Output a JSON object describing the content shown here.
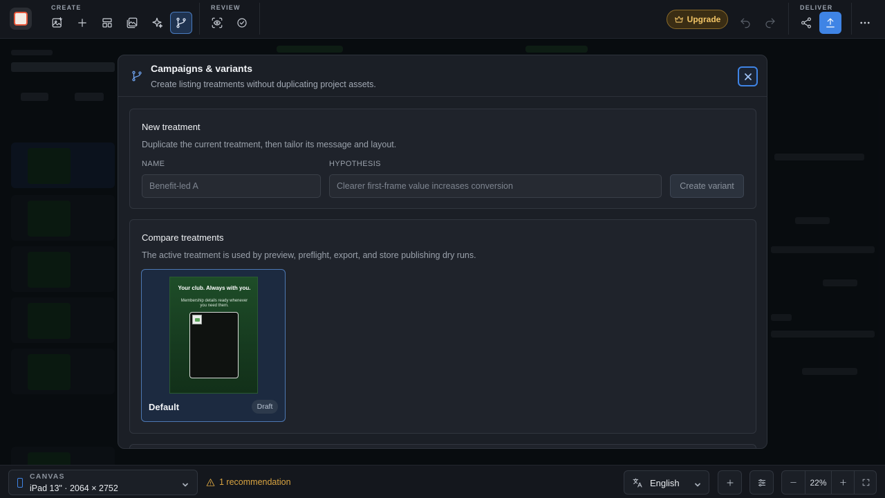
{
  "toolbar": {
    "create_label": "CREATE",
    "review_label": "REVIEW",
    "deliver_label": "DELIVER",
    "upgrade_label": "Upgrade",
    "icons": {
      "create": [
        "image-add-icon",
        "plus-icon",
        "layout-icon",
        "gallery-icon",
        "sparkles-icon",
        "branch-icon"
      ],
      "review": [
        "eye-scan-icon",
        "check-circle-icon"
      ],
      "deliver": [
        "share-icon",
        "upload-icon"
      ]
    },
    "colors": {
      "accent": "#3f84e5",
      "upgrade": "#f3c567"
    }
  },
  "modal": {
    "title": "Campaigns & variants",
    "subtitle": "Create listing treatments without duplicating project assets.",
    "new_treatment": {
      "title": "New treatment",
      "description": "Duplicate the current treatment, then tailor its message and layout.",
      "name_label": "NAME",
      "name_value": "",
      "name_placeholder": "Benefit-led A",
      "hypothesis_label": "HYPOTHESIS",
      "hypothesis_value": "",
      "hypothesis_placeholder": "Clearer first-frame value increases conversion",
      "create_button": "Create variant"
    },
    "compare": {
      "title": "Compare treatments",
      "description": "The active treatment is used by preview, preflight, export, and store publishing dry runs.",
      "variants": [
        {
          "name": "Default",
          "status": "Draft",
          "preview_headline": "Your club. Always with you.",
          "preview_subtext": "Membership details ready whenever you need them."
        }
      ]
    }
  },
  "bottombar": {
    "canvas_label": "CANVAS",
    "canvas_value": "iPad 13\" · 2064 × 2752",
    "recommendation": "1 recommendation",
    "language": "English",
    "zoom": "22%"
  }
}
